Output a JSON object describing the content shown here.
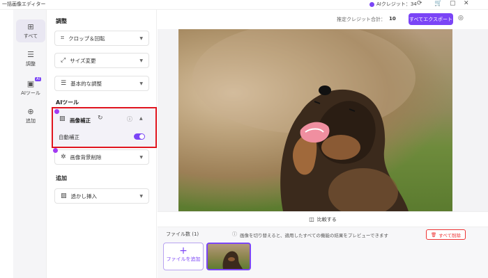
{
  "app": {
    "title": "一括画像エディター"
  },
  "titlebar": {
    "credits_label": "AIクレジット：34",
    "refresh_icon": "refresh-icon",
    "cart_icon": "cart-icon",
    "window_icon": "window-icon",
    "close_icon": "close-icon"
  },
  "sidebar": {
    "items": [
      {
        "label": "すべて",
        "icon": "grid-icon",
        "active": true
      },
      {
        "label": "調整",
        "icon": "sliders-icon"
      },
      {
        "label": "AIツール",
        "icon": "ai-icon",
        "badge": "AI"
      },
      {
        "label": "追加",
        "icon": "plus-icon"
      }
    ]
  },
  "panel": {
    "adjust_label": "調整",
    "adjust_items": [
      {
        "label": "クロップ＆回転",
        "icon": "crop-icon"
      },
      {
        "label": "サイズ変更",
        "icon": "resize-icon"
      },
      {
        "label": "基本的な調整",
        "icon": "sliders-icon"
      }
    ],
    "ai_label": "AIツール",
    "enhance": {
      "label": "画像補正",
      "auto_label": "自動補正",
      "auto_on": true
    },
    "bg_remove": {
      "label": "画像背景削除"
    },
    "add_label": "追加",
    "watermark": {
      "label": "透かし挿入"
    }
  },
  "header": {
    "estimated_credits_label": "推定クレジット合計：",
    "estimated_credits_value": "10",
    "export_label": "すべてエクスポート"
  },
  "canvas": {
    "compare_label": "比較する"
  },
  "files": {
    "count_label": "ファイル数 (1)",
    "notice": "画像を切り替えると、適用したすべての機能の結果をプレビューできます",
    "delete_all_label": "すべて削除",
    "add_file_label": "ファイルを追加"
  },
  "colors": {
    "accent": "#7b45f6",
    "highlight": "#e0141e",
    "delete": "#e33333"
  }
}
